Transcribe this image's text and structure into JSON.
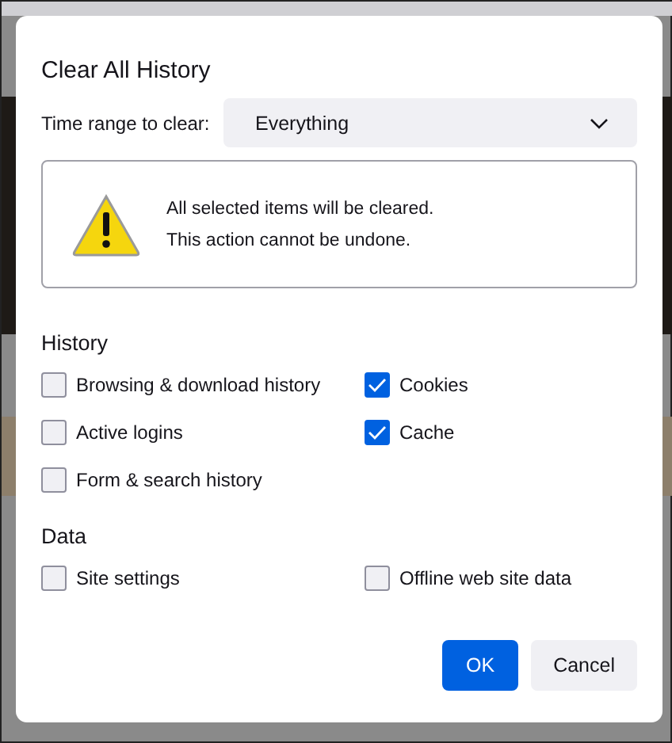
{
  "dialog": {
    "title": "Clear All History"
  },
  "time_range": {
    "label": "Time range to clear:",
    "value": "Everything"
  },
  "warning": {
    "lines": [
      "All selected items will be cleared.",
      "This action cannot be undone."
    ]
  },
  "sections": [
    {
      "heading": "History",
      "items": [
        {
          "label": "Browsing & download history",
          "checked": false
        },
        {
          "label": "Cookies",
          "checked": true
        },
        {
          "label": "Active logins",
          "checked": false
        },
        {
          "label": "Cache",
          "checked": true
        },
        {
          "label": "Form & search history",
          "checked": false
        }
      ]
    },
    {
      "heading": "Data",
      "items": [
        {
          "label": "Site settings",
          "checked": false
        },
        {
          "label": "Offline web site data",
          "checked": false
        }
      ]
    }
  ],
  "buttons": [
    {
      "label": "OK",
      "kind": "primary"
    },
    {
      "label": "Cancel",
      "kind": "secondary"
    }
  ]
}
